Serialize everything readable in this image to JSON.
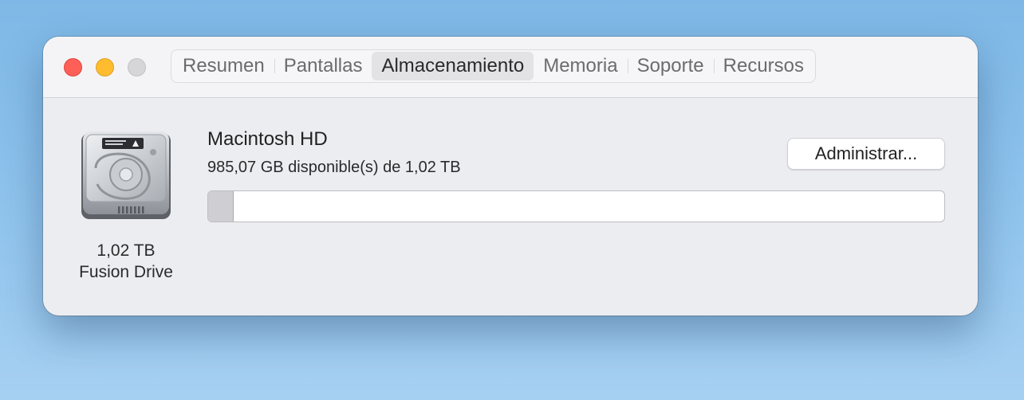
{
  "window": {
    "tabs": [
      {
        "label": "Resumen",
        "active": false
      },
      {
        "label": "Pantallas",
        "active": false
      },
      {
        "label": "Almacenamiento",
        "active": true
      },
      {
        "label": "Memoria",
        "active": false
      },
      {
        "label": "Soporte",
        "active": false
      },
      {
        "label": "Recursos",
        "active": false
      }
    ]
  },
  "disk": {
    "icon": "hard-drive-icon",
    "size": "1,02 TB",
    "type": "Fusion Drive"
  },
  "volume": {
    "name": "Macintosh HD",
    "available": "985,07 GB disponible(s) de 1,02 TB",
    "used_fraction": 0.034
  },
  "actions": {
    "manage_label": "Administrar..."
  },
  "colors": {
    "close": "#fe5f57",
    "minimize": "#febc2e",
    "zoom": "#d6d6d8"
  }
}
